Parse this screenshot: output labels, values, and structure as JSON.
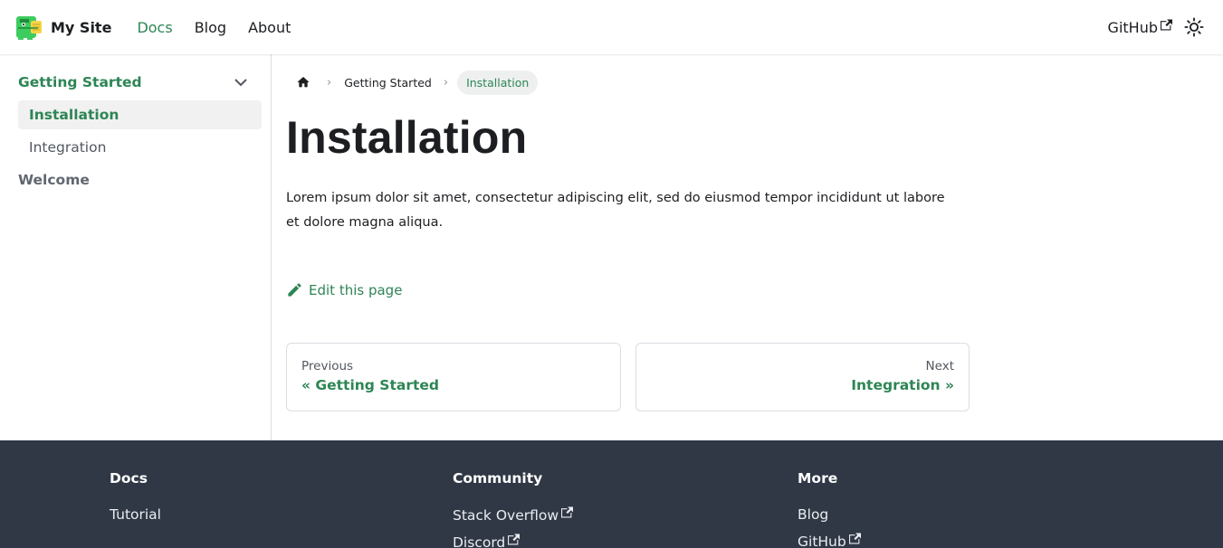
{
  "navbar": {
    "brand_title": "My Site",
    "links": [
      "Docs",
      "Blog",
      "About"
    ],
    "github_label": "GitHub",
    "accent_color": "#2e8555"
  },
  "sidebar": {
    "category_label": "Getting Started",
    "items": [
      "Installation",
      "Integration"
    ],
    "top_item": "Welcome"
  },
  "breadcrumbs": {
    "items": [
      "Getting Started",
      "Installation"
    ]
  },
  "doc": {
    "title": "Installation",
    "body": "Lorem ipsum dolor sit amet, consectetur adipiscing elit, sed do eiusmod tempor incididunt ut labore et dolore magna aliqua.",
    "edit_label": "Edit this page"
  },
  "pager": {
    "prev_sub": "Previous",
    "prev_label": "« Getting Started",
    "next_sub": "Next",
    "next_label": "Integration »"
  },
  "footer": {
    "columns": [
      {
        "title": "Docs",
        "links": [
          "Tutorial"
        ]
      },
      {
        "title": "Community",
        "links": [
          "Stack Overflow",
          "Discord"
        ]
      },
      {
        "title": "More",
        "links": [
          "Blog",
          "GitHub"
        ]
      }
    ]
  }
}
